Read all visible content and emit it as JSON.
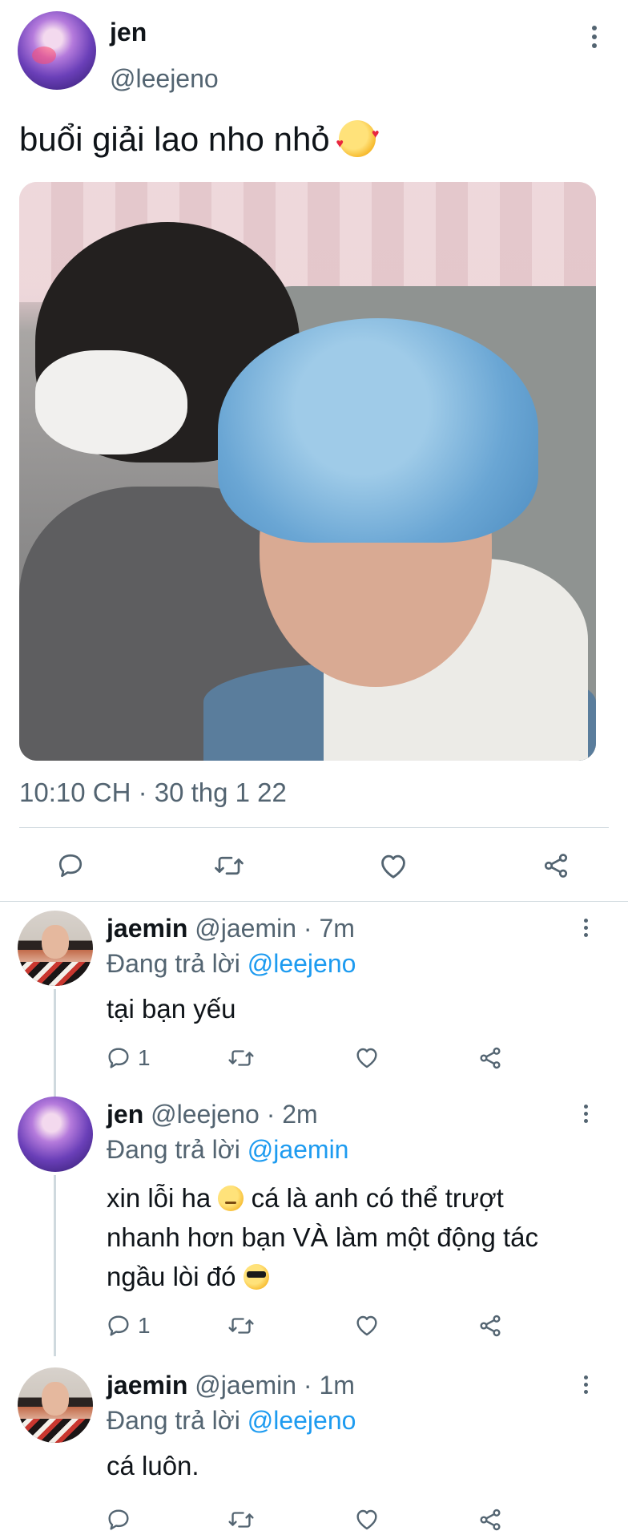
{
  "main_tweet": {
    "author_name": "jen",
    "author_handle": "@leejeno",
    "text": "buổi giải lao nho nhỏ",
    "text_emoji": "smiling-face-with-hearts",
    "timestamp": "10:10 CH · 30 thg 1 22",
    "actions": [
      "reply-icon",
      "retweet-icon",
      "like-icon",
      "share-icon"
    ]
  },
  "replies": [
    {
      "name": "jaemin",
      "handle": "@jaemin",
      "time": "7m",
      "meta": "@jaemin · 7m",
      "replying_prefix": "Đang trả lời",
      "replying_to": "@leejeno",
      "text": "tại bạn yếu",
      "reply_count": "1"
    },
    {
      "name": "jen",
      "handle": "@leejeno",
      "time": "2m",
      "meta": "@leejeno · 2m",
      "replying_prefix": "Đang trả lời",
      "replying_to": "@jaemin",
      "text_part1": "xin lỗi ha",
      "text_part2": "cá là anh có thể trượt nhanh hơn bạn VÀ làm một động tác ngầu lòi đó",
      "emojis": [
        "smirking-face",
        "sunglasses-face"
      ],
      "reply_count": "1"
    },
    {
      "name": "jaemin",
      "handle": "@jaemin",
      "time": "1m",
      "meta": "@jaemin · 1m",
      "replying_prefix": "Đang trả lời",
      "replying_to": "@leejeno",
      "text": "cá luôn.",
      "reply_count": ""
    }
  ],
  "colors": {
    "text": "#0f1419",
    "secondary": "#536471",
    "link": "#1d9bf0",
    "divider": "#cfd9de"
  }
}
